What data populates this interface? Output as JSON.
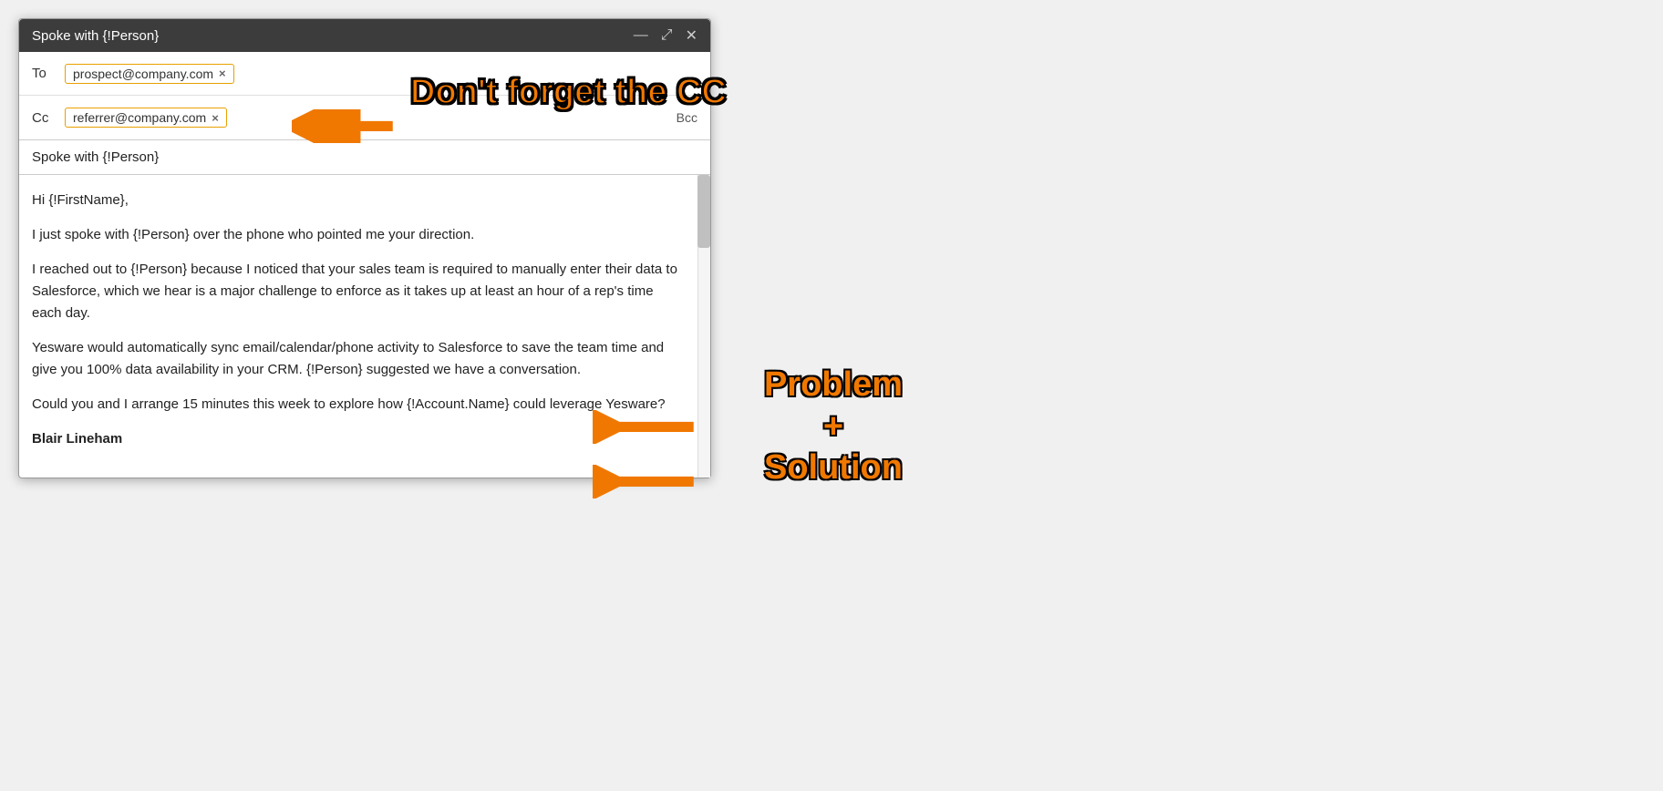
{
  "window": {
    "title": "Spoke with {!Person}",
    "controls": {
      "minimize": "—",
      "maximize": "⤢",
      "close": "✕"
    }
  },
  "fields": {
    "to_label": "To",
    "to_email": "prospect@company.com",
    "cc_label": "Cc",
    "cc_email": "referrer@company.com",
    "bcc_label": "Bcc"
  },
  "subject": "Spoke with {!Person}",
  "body": {
    "line1": "Hi {!FirstName},",
    "line2": "I just spoke with {!Person} over the phone who pointed me your direction.",
    "line3": "I reached out to {!Person} because I noticed that your sales team is required to manually enter their data to Salesforce, which we hear is a major challenge to enforce as it takes up at least an hour of a rep's time each day.",
    "line4": "Yesware would automatically sync email/calendar/phone activity to Salesforce to save the team time and give you 100% data availability in your CRM. {!Person} suggested we have a conversation.",
    "line5": "Could you and I arrange 15 minutes this week to explore how {!Account.Name} could leverage Yesware?",
    "line6": "Blair Lineham"
  },
  "annotations": {
    "cc_callout": "Don't forget the CC",
    "problem_callout_line1": "Problem",
    "problem_callout_line2": "+",
    "problem_callout_line3": "Solution"
  }
}
